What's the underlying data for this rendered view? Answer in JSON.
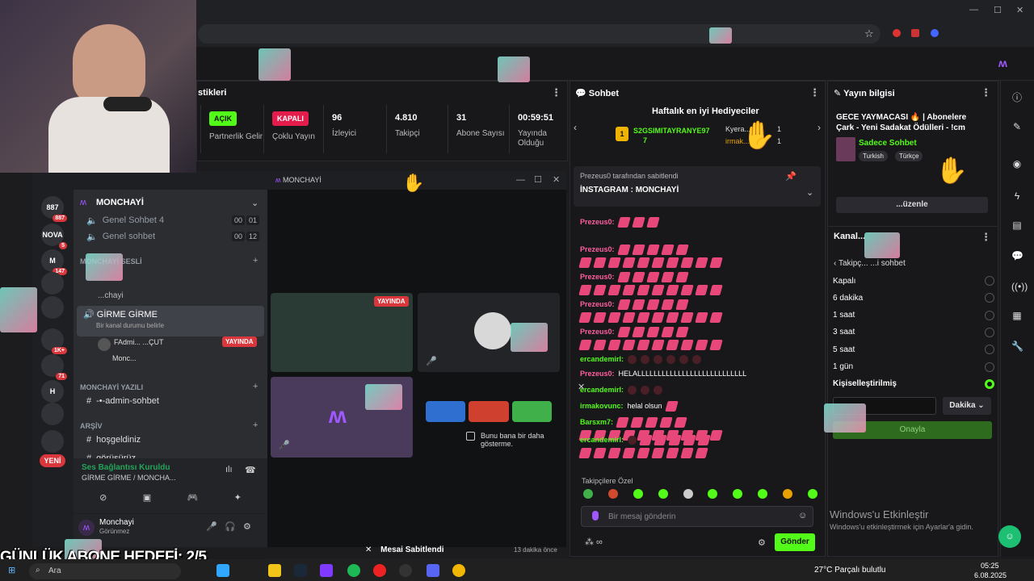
{
  "stats": {
    "title": "stikleri",
    "items": [
      {
        "badge": "AÇIK",
        "badge_color": "#53fc18",
        "label": "Partnerlik Gelir"
      },
      {
        "badge": "KAPALI",
        "badge_color": "#e31c4c",
        "label": "Çoklu Yayın"
      },
      {
        "value": "96",
        "label": "İzleyici"
      },
      {
        "value": "4.810",
        "label": "Takipçi"
      },
      {
        "value": "31",
        "label": "Abone Sayısı"
      },
      {
        "value": "00:59:51",
        "label": "Yayında Olduğu"
      }
    ]
  },
  "discord": {
    "window_title": "MONCHAYİ",
    "server_name": "MONCHAYİ",
    "servers": [
      {
        "label": "887",
        "badge": "887"
      },
      {
        "label": "NOVA",
        "badge": "5"
      },
      {
        "label": "M",
        "badge": "147"
      },
      {
        "label": "",
        "badge": ""
      },
      {
        "label": "",
        "badge": ""
      },
      {
        "label": "",
        "badge": "1K+"
      },
      {
        "label": "",
        "badge": "71"
      },
      {
        "label": "H",
        "badge": ""
      },
      {
        "label": "",
        "badge": ""
      },
      {
        "label": "",
        "badge": ""
      },
      {
        "label": "YENİ",
        "badge": ""
      }
    ],
    "channels_top": [
      {
        "name": "Genel Sohbet 4",
        "count_a": "00",
        "count_b": "01"
      },
      {
        "name": "Genel sohbet",
        "count_a": "00",
        "count_b": "12"
      }
    ],
    "cat_voice": "MONCHAYİ SESLİ",
    "voice_user_partial": "...chayi",
    "active_channel": "GİRME GİRME",
    "active_channel_sub": "Bir kanal durumu belirle",
    "live_user": "FAdmi... ...ÇUT",
    "live_badge": "YAYINDA",
    "user2": "Monc...",
    "cat_text": "MONCHAYİ YAZILI",
    "admin_channel": "-•-admin-sohbet",
    "cat_archive": "ARŞİV",
    "archive_channels": [
      "hoşgeldiniz",
      "görüşürüz"
    ],
    "voice_status": "Ses Bağlantısı Kuruldu",
    "voice_location": "GİRME GİRME / MONCHA...",
    "me_name": "Monchayi",
    "me_status": "Görünmez",
    "stage_live": "YAYINDA",
    "popup_text": "Bunu bana bir daha gösterme.",
    "pinned_label": "Mesai Sabitlendi",
    "pinned_time": "13 dakika önce"
  },
  "chat": {
    "title": "Sohbet",
    "gifters_title": "Haftalık en iyi Hediyeciler",
    "gifter1": "S2GSIMITAYRANYE97",
    "gifter1_count": "7",
    "gifter2": "Kyera...",
    "gifter2_count": "1",
    "gifter3": "irmak...",
    "gifter3_count": "1",
    "pinned_by": "Prezeus0 tarafından sabitlendi",
    "pinned_text": "İNSTAGRAM : MONCHAYİ",
    "messages": [
      {
        "user": "Prezeus0:",
        "text": ""
      },
      {
        "user": "Prezeus0:",
        "text": ""
      },
      {
        "user": "Prezeus0:",
        "text": ""
      },
      {
        "user": "Prezeus0:",
        "text": ""
      },
      {
        "user": "Prezeus0:",
        "text": ""
      },
      {
        "user": "ercandemirl:",
        "text": ""
      },
      {
        "user": "Prezeus0:",
        "text": "HELALLLLLLLLLLLLLLLLLLLLLLLLLLL"
      },
      {
        "user": "ercandemirl:",
        "text": ""
      },
      {
        "user": "irmakovunc:",
        "text": "helal olsun"
      },
      {
        "user": "Barsxm7:",
        "text": ""
      },
      {
        "user": "ercandemirl:",
        "text": ""
      }
    ],
    "followers_only": "Takipçilere Özel",
    "input_placeholder": "Bir mesaj gönderin",
    "send_label": "Gönder"
  },
  "info": {
    "title": "Yayın bilgisi",
    "stream_title": "GECE YAYMACASI 🔥 | Abonelere Çark - Yeni Sadakat Ödülleri - !cm",
    "category": "Sadece Sohbet",
    "tags": [
      "Turkish",
      "Türkçe"
    ],
    "edit_label": "...üzenle",
    "channel_title": "Kanal...",
    "back_label": "Takipç... ...i sohbet",
    "options": [
      "Kapalı",
      "6 dakika",
      "1 saat",
      "3 saat",
      "5 saat",
      "1 gün",
      "Kişiselleştirilmiş"
    ],
    "selected": "Kişiselleştirilmiş",
    "unit": "Dakika",
    "confirm": "Onayla"
  },
  "overlay": {
    "goal": "GÜNLÜK ABONE HEDEFİ: 2/5",
    "win_title": "Windows'u Etkinleştir",
    "win_sub": "Windows'u etkinleştirmek için Ayarlar'a gidin."
  },
  "taskbar": {
    "search": "Ara",
    "weather": "27°C  Parçalı bulutlu",
    "time": "05:25",
    "date": "6.08.2025"
  },
  "colors": {
    "kick_green": "#53fc18",
    "discord_red": "#da373c",
    "chat_pink": "#ff5fa0"
  }
}
